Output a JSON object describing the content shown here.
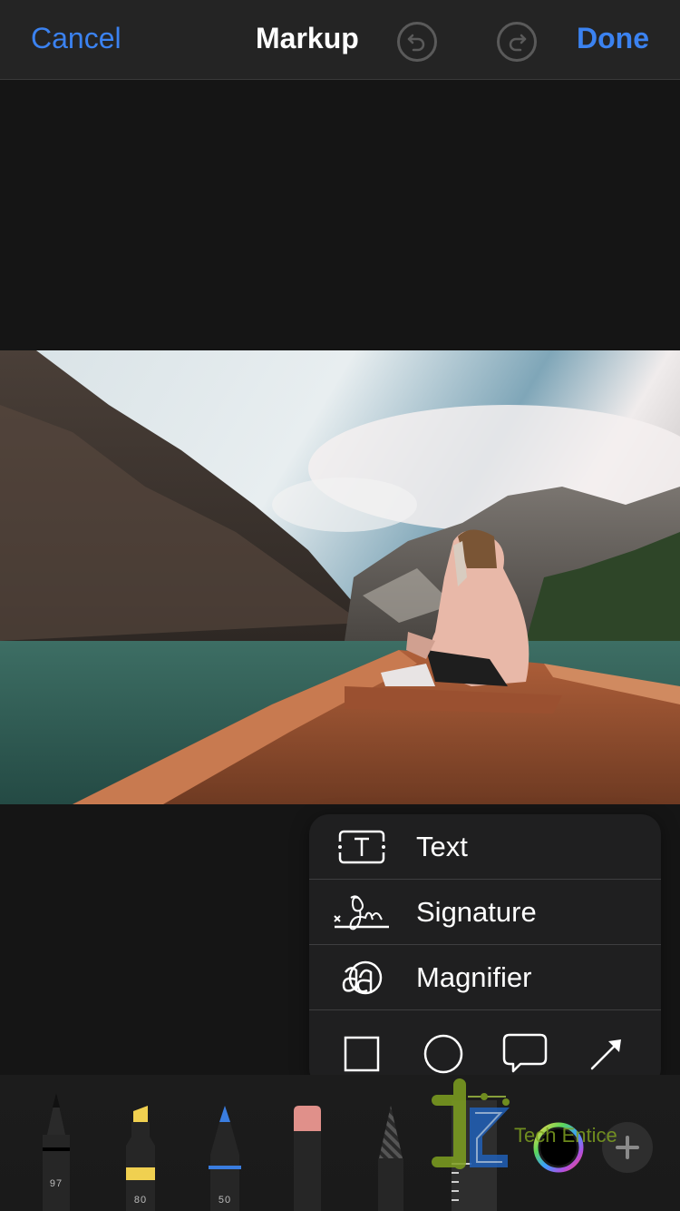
{
  "navbar": {
    "cancel_label": "Cancel",
    "title": "Markup",
    "done_label": "Done",
    "undo_icon": "undo-icon",
    "redo_icon": "redo-icon",
    "accent_color": "#3b82f0"
  },
  "canvas": {
    "image_description": "Woman in pink jacket sitting on wooden boat on green lake with mountains and cloudy sky"
  },
  "popup_menu": {
    "items": [
      {
        "label": "Text",
        "icon": "text-box-icon"
      },
      {
        "label": "Signature",
        "icon": "signature-icon"
      },
      {
        "label": "Magnifier",
        "icon": "magnifier-icon"
      }
    ],
    "shapes": [
      {
        "name": "square",
        "icon": "square-icon"
      },
      {
        "name": "circle",
        "icon": "circle-icon"
      },
      {
        "name": "speech-bubble",
        "icon": "speech-bubble-icon"
      },
      {
        "name": "arrow",
        "icon": "arrow-icon"
      }
    ]
  },
  "toolbar": {
    "tools": [
      {
        "name": "pen",
        "value": "97",
        "color": "#000000"
      },
      {
        "name": "highlighter",
        "value": "80",
        "color": "#f0d050"
      },
      {
        "name": "pencil",
        "value": "50",
        "color": "#3a7de0"
      },
      {
        "name": "eraser",
        "value": ""
      },
      {
        "name": "lasso",
        "value": ""
      },
      {
        "name": "ruler",
        "value": ""
      }
    ],
    "color_picker_icon": "color-wheel-icon",
    "add_icon": "plus-icon"
  },
  "watermark": {
    "text": "Tech Entice"
  }
}
